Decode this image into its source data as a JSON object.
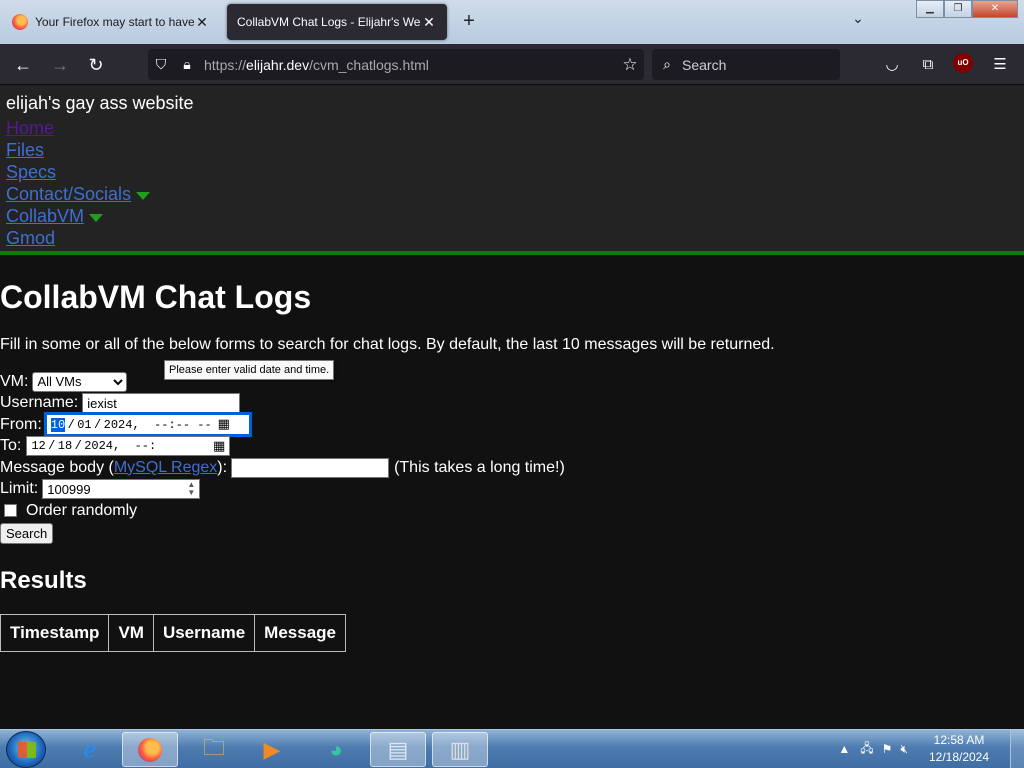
{
  "browser": {
    "tabs": [
      {
        "title": "Your Firefox may start to have p",
        "active": false
      },
      {
        "title": "CollabVM Chat Logs - Elijahr's Web",
        "active": true
      }
    ],
    "url_prefix": "https://",
    "url_domain": "elijahr.dev",
    "url_path": "/cvm_chatlogs.html",
    "search_placeholder": "Search",
    "ublock_label": "uO"
  },
  "site": {
    "title": "elijah's gay ass website",
    "nav": [
      "Home",
      "Files",
      "Specs",
      "Contact/Socials",
      "CollabVM",
      "Gmod"
    ]
  },
  "main": {
    "heading": "CollabVM Chat Logs",
    "intro": "Fill in some or all of the below forms to search for chat logs. By default, the last 10 messages will be returned.",
    "vm_label": "VM:",
    "vm_selected": "All VMs",
    "username_label": "Username:",
    "username_value": "iexist",
    "from_label": "From:",
    "from_month": "10",
    "from_day": "01",
    "from_year": "2024",
    "time_placeholder": "--:-- --",
    "to_label": "To:",
    "to_month": "12",
    "to_day": "18",
    "to_year": "2024",
    "to_time_placeholder": "--:",
    "tooltip": "Please enter valid date and time.",
    "message_label_pre": "Message body (",
    "message_link": "MySQL Regex",
    "message_label_post": "):",
    "message_note": "(This takes a long time!)",
    "limit_label": "Limit:",
    "limit_value": "100999",
    "random_label": "Order randomly",
    "search_button": "Search",
    "results_heading": "Results",
    "columns": [
      "Timestamp",
      "VM",
      "Username",
      "Message"
    ]
  },
  "taskbar": {
    "time": "12:58 AM",
    "date": "12/18/2024"
  },
  "colors": {
    "link": "#3e6fd0",
    "visited": "#551a8b",
    "accent_green": "#0f7a0f"
  }
}
